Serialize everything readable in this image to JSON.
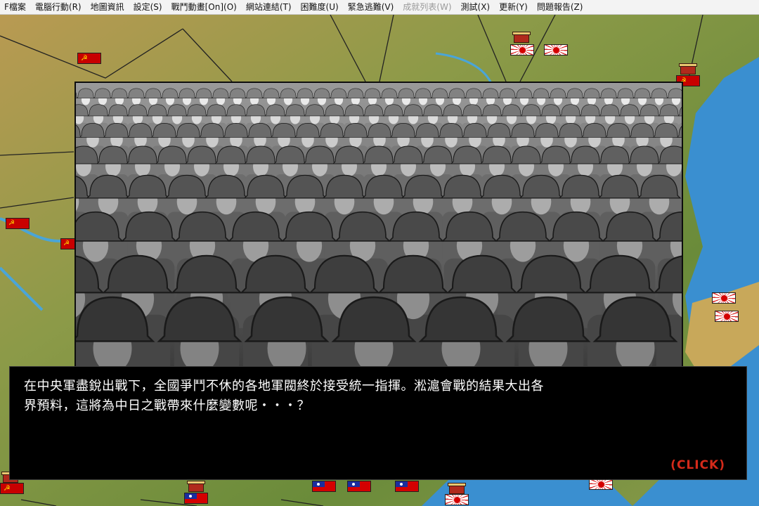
{
  "menu": [
    {
      "label": "F檔案",
      "enabled": true
    },
    {
      "label": "電腦行動(R)",
      "enabled": true
    },
    {
      "label": "地圖資訊",
      "enabled": true
    },
    {
      "label": "設定(S)",
      "enabled": true
    },
    {
      "label": "戰鬥動畫[On](O)",
      "enabled": true
    },
    {
      "label": "網站連結(T)",
      "enabled": true
    },
    {
      "label": "困難度(U)",
      "enabled": true
    },
    {
      "label": "緊急逃難(V)",
      "enabled": true
    },
    {
      "label": "成就列表(W)",
      "enabled": false
    },
    {
      "label": "測試(X)",
      "enabled": true
    },
    {
      "label": "更新(Y)",
      "enabled": true
    },
    {
      "label": "問題報告(Z)",
      "enabled": true
    }
  ],
  "event_image": {
    "subject": "infantry-formation-photo"
  },
  "dialog": {
    "line1": "在中央軍盡銳出戰下，全國爭鬥不休的各地軍閥終於接受統一指揮。淞滬會戰的結果大出各",
    "line2": "界預料，這將為中日之戰帶來什麼變數呢・・・？",
    "continue_label": "(CLICK)"
  },
  "colors": {
    "dialog_bg": "#000000",
    "dialog_text": "#ffffff",
    "click_text": "#d42a1a",
    "sea": "#3a8fd0"
  }
}
